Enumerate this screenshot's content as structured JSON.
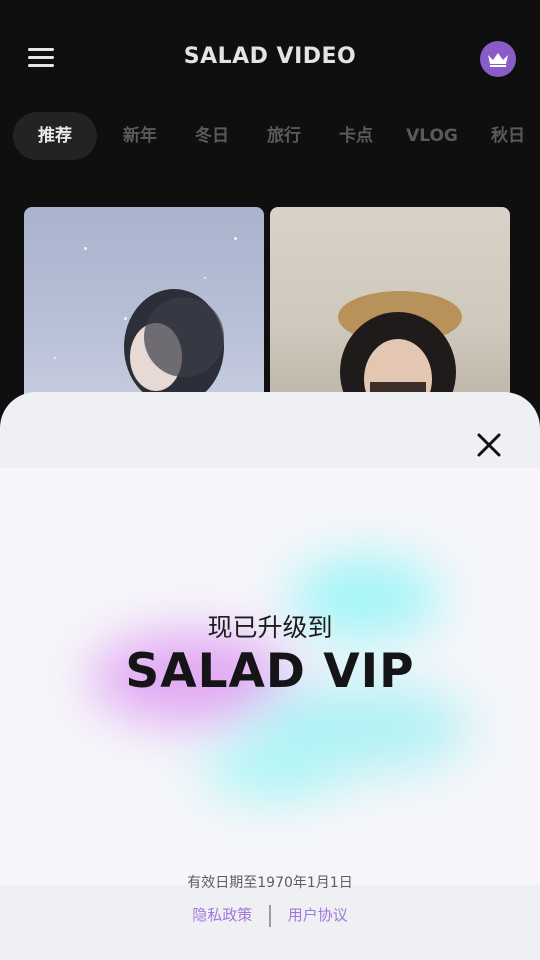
{
  "header": {
    "title": "SALAD VIDEO"
  },
  "tabs": [
    {
      "label": "推荐",
      "active": true
    },
    {
      "label": "新年",
      "active": false
    },
    {
      "label": "冬日",
      "active": false
    },
    {
      "label": "旅行",
      "active": false
    },
    {
      "label": "卡点",
      "active": false
    },
    {
      "label": "VLOG",
      "active": false
    },
    {
      "label": "秋日",
      "active": false
    }
  ],
  "vip_sheet": {
    "subtitle": "现已升级到",
    "title": "SALAD VIP",
    "validity": "有效日期至1970年1月1日",
    "privacy_link": "隐私政策",
    "terms_link": "用户协议"
  },
  "colors": {
    "accent": "#8a5cc8",
    "link": "#a07ad8",
    "background": "#0f0f10"
  }
}
